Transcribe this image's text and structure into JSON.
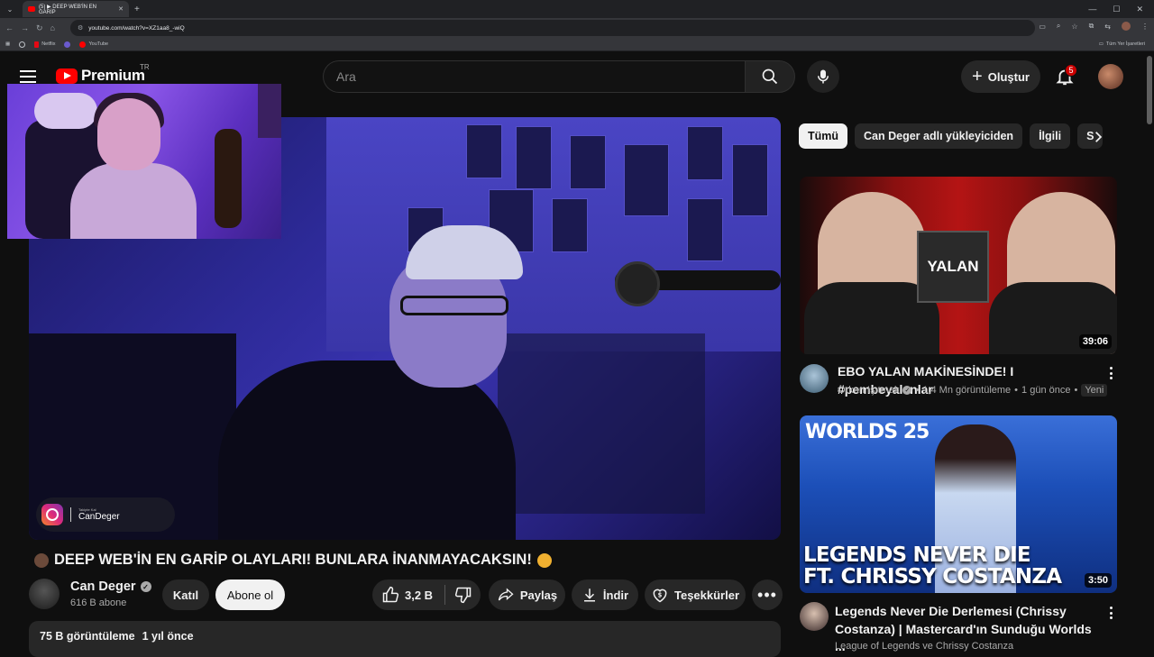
{
  "browser": {
    "tab_title": "(5) ▶ DEEP WEB'İN EN GARİP",
    "address": "youtube.com/watch?v=XZ1aa8_-wiQ",
    "bookmarks": [
      {
        "label": "Netflix",
        "color": "#e50914"
      },
      {
        "label": "YouTube",
        "color": "#ff0000"
      }
    ],
    "all_bookmarks": "Tüm Yer İşaretleri"
  },
  "header": {
    "logo_text": "Premium",
    "country_code": "TR",
    "search_placeholder": "Ara",
    "create_label": "Oluştur",
    "notification_count": "5"
  },
  "player": {
    "overlay_small": "Takipte Kal",
    "overlay_handle": "CanDeger"
  },
  "video": {
    "title": "DEEP WEB'İN EN GARİP OLAYLARI! BUNLARA İNANMAYACAKSIN!",
    "channel": "Can Deger",
    "subscribers": "616 B abone",
    "join_label": "Katıl",
    "subscribe_label": "Abone ol",
    "likes": "3,2 B",
    "share_label": "Paylaş",
    "download_label": "İndir",
    "thanks_label": "Teşekkürler",
    "views": "75 B görüntüleme",
    "age": "1 yıl önce"
  },
  "sidebar": {
    "chips": [
      "Tümü",
      "Can Deger adlı yükleyiciden",
      "İlgili",
      "S"
    ],
    "recommendations": [
      {
        "thumb_text": "YALAN",
        "duration": "39:06",
        "title": "EBO YALAN MAKİNESİNDE! I #pembeyalanlar",
        "channel": "Orkun Işıtmak",
        "views": "1,4 Mn görüntüleme",
        "age": "1 gün önce",
        "badge": "Yeni"
      },
      {
        "thumb_top": "WORLDS 25",
        "thumb_text": "LEGENDS NEVER DIE\nFT. CHRISSY COSTANZA",
        "duration": "3:50",
        "title": "Legends Never Die Derlemesi (Chrissy Costanza) | Mastercard'ın Sunduğu Worlds ...",
        "channel": "League of Legends ve Chrissy Costanza"
      }
    ]
  },
  "colors": {
    "background": "#0f0f0f",
    "brand_red": "#ff0000",
    "chip_bg": "#272727",
    "text": "#f1f1f1",
    "muted": "#aaaaaa"
  }
}
